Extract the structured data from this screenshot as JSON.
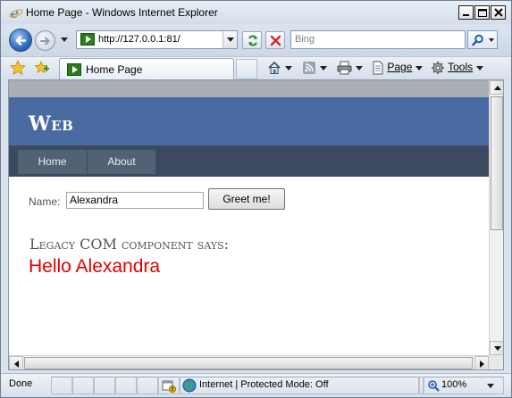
{
  "window": {
    "title": "Home Page - Windows Internet Explorer"
  },
  "address_bar": {
    "url": "http://127.0.0.1:81/",
    "search_placeholder": "Bing"
  },
  "command_bar": {
    "tab_label": "Home Page",
    "page_menu": "Page",
    "tools_menu": "Tools"
  },
  "site": {
    "title": "Web",
    "menu": [
      {
        "label": "Home"
      },
      {
        "label": "About"
      }
    ],
    "form": {
      "name_label": "Name:",
      "name_value": "Alexandra",
      "greet_button": "Greet me!"
    },
    "says_heading": "Legacy COM component says:",
    "result": "Hello Alexandra"
  },
  "status_bar": {
    "status": "Done",
    "zone": "Internet | Protected Mode: Off",
    "zoom": "100%"
  },
  "colors": {
    "header_blue": "#4a6aa2",
    "menu_dark": "#3b4a5e",
    "result_red": "#e00000"
  }
}
